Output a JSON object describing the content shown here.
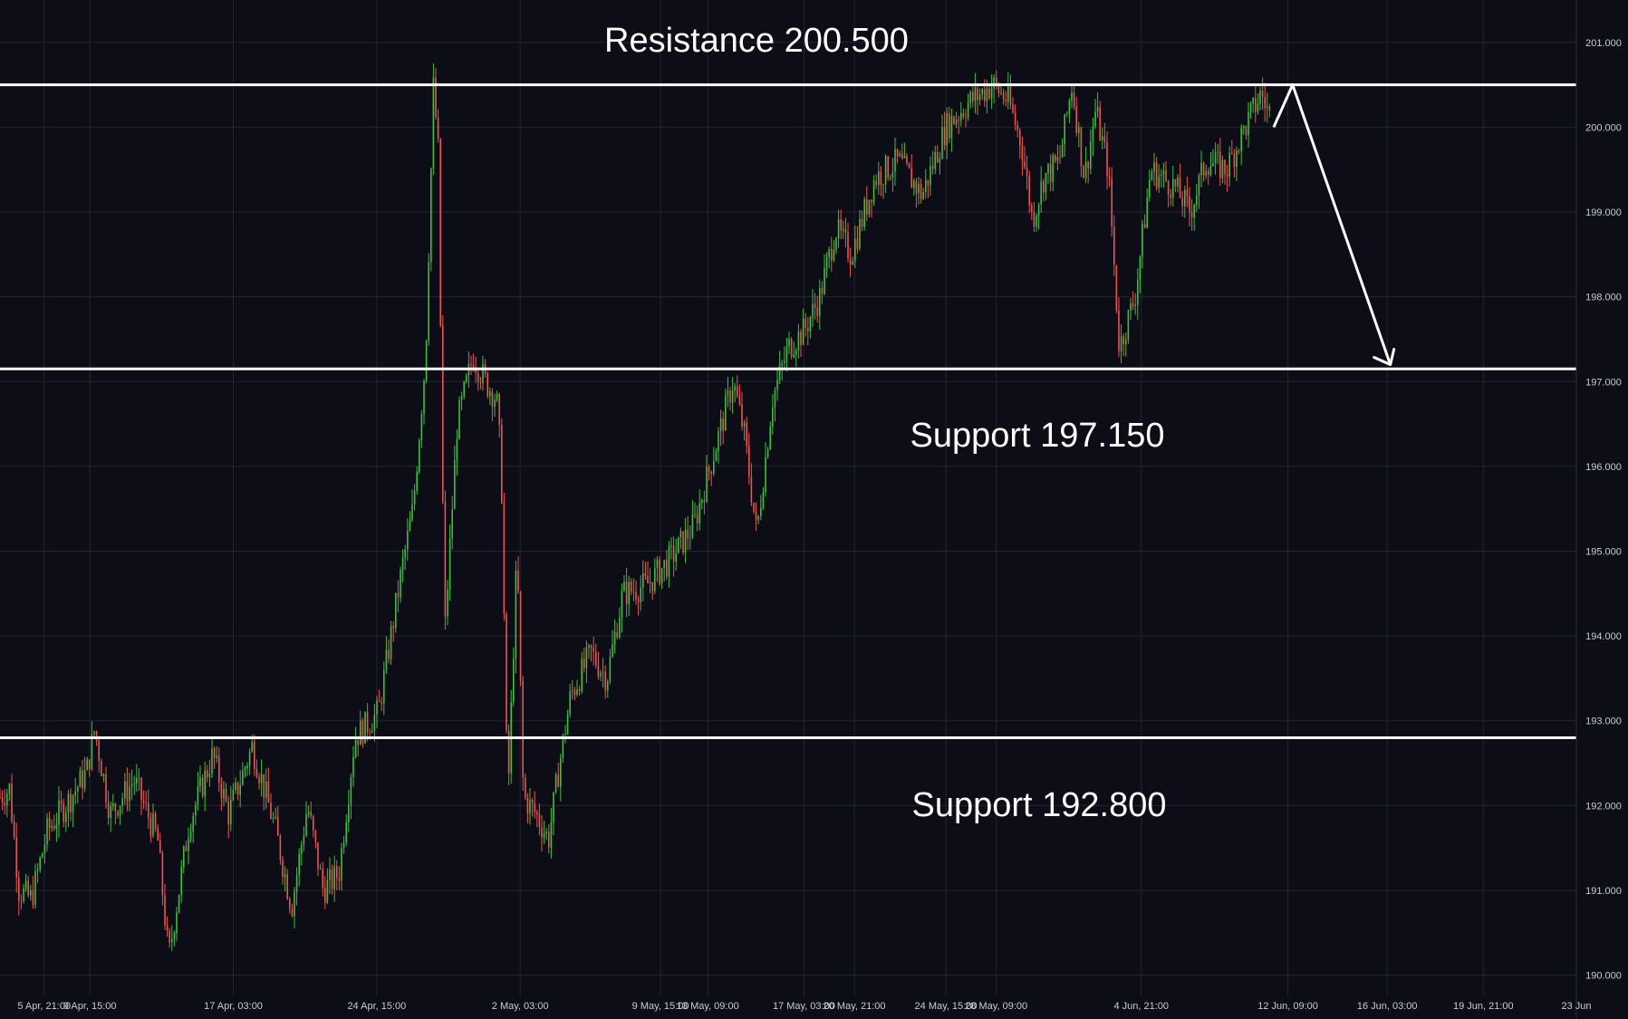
{
  "chart_data": {
    "type": "candlestick",
    "ylim": [
      189.75,
      201.5
    ],
    "y_ticks": [
      "190.000",
      "191.000",
      "192.000",
      "193.000",
      "194.000",
      "195.000",
      "196.000",
      "197.000",
      "198.000",
      "199.000",
      "200.000",
      "201.000"
    ],
    "x_ticks": [
      "5 Apr, 21:00",
      "9 Apr, 15:00",
      "17 Apr, 03:00",
      "24 Apr, 15:00",
      "2 May, 03:00",
      "9 May, 15:00",
      "13 May, 09:00",
      "17 May, 03:00",
      "20 May, 21:00",
      "24 May, 15:00",
      "28 May, 09:00",
      "4 Jun, 21:00",
      "12 Jun, 09:00",
      "16 Jun, 03:00",
      "19 Jun, 21:00",
      "23 Jun"
    ],
    "grid": true,
    "colors": {
      "up": "#26a69a",
      "up_bright": "#3fbf3f",
      "down": "#ef5350",
      "level": "#ffffff",
      "background": "#0c0d17"
    },
    "levels": [
      {
        "value": 200.5,
        "tag": "200.500",
        "label": "Resistance 200.500"
      },
      {
        "value": 197.15,
        "tag": "197.150",
        "label": "Support 197.150"
      },
      {
        "value": 192.8,
        "tag": "192.800",
        "label": "Support 192.800"
      }
    ],
    "price_path": [
      [
        0,
        192.1
      ],
      [
        0.006,
        192.2
      ],
      [
        0.012,
        191.0
      ],
      [
        0.02,
        190.9
      ],
      [
        0.03,
        191.7
      ],
      [
        0.045,
        192.1
      ],
      [
        0.055,
        192.4
      ],
      [
        0.06,
        192.9
      ],
      [
        0.07,
        191.9
      ],
      [
        0.085,
        192.3
      ],
      [
        0.1,
        191.6
      ],
      [
        0.107,
        190.2
      ],
      [
        0.12,
        191.8
      ],
      [
        0.135,
        192.6
      ],
      [
        0.145,
        191.9
      ],
      [
        0.16,
        192.7
      ],
      [
        0.175,
        191.7
      ],
      [
        0.185,
        190.8
      ],
      [
        0.195,
        192.0
      ],
      [
        0.205,
        191.0
      ],
      [
        0.215,
        191.2
      ],
      [
        0.225,
        192.8
      ],
      [
        0.24,
        193.1
      ],
      [
        0.255,
        194.8
      ],
      [
        0.262,
        195.5
      ],
      [
        0.27,
        197.3
      ],
      [
        0.275,
        200.5
      ],
      [
        0.278,
        199.7
      ],
      [
        0.282,
        194.0
      ],
      [
        0.29,
        196.5
      ],
      [
        0.3,
        197.3
      ],
      [
        0.308,
        197.0
      ],
      [
        0.315,
        196.8
      ],
      [
        0.318,
        196.0
      ],
      [
        0.322,
        192.0
      ],
      [
        0.328,
        195.0
      ],
      [
        0.332,
        192.1
      ],
      [
        0.34,
        191.9
      ],
      [
        0.348,
        191.6
      ],
      [
        0.355,
        192.5
      ],
      [
        0.362,
        193.3
      ],
      [
        0.375,
        193.8
      ],
      [
        0.385,
        193.5
      ],
      [
        0.395,
        194.5
      ],
      [
        0.41,
        194.6
      ],
      [
        0.425,
        194.9
      ],
      [
        0.44,
        195.3
      ],
      [
        0.455,
        196.3
      ],
      [
        0.465,
        197.0
      ],
      [
        0.472,
        196.4
      ],
      [
        0.48,
        195.2
      ],
      [
        0.49,
        196.8
      ],
      [
        0.5,
        197.4
      ],
      [
        0.51,
        197.6
      ],
      [
        0.52,
        198.0
      ],
      [
        0.53,
        198.8
      ],
      [
        0.54,
        198.5
      ],
      [
        0.555,
        199.4
      ],
      [
        0.57,
        199.6
      ],
      [
        0.585,
        199.2
      ],
      [
        0.6,
        200.0
      ],
      [
        0.615,
        200.3
      ],
      [
        0.63,
        200.5
      ],
      [
        0.64,
        200.3
      ],
      [
        0.648,
        199.8
      ],
      [
        0.655,
        198.9
      ],
      [
        0.662,
        199.4
      ],
      [
        0.672,
        199.6
      ],
      [
        0.68,
        200.5
      ],
      [
        0.688,
        199.4
      ],
      [
        0.695,
        200.2
      ],
      [
        0.703,
        199.5
      ],
      [
        0.71,
        197.4
      ],
      [
        0.72,
        198.0
      ],
      [
        0.73,
        199.5
      ],
      [
        0.745,
        199.3
      ],
      [
        0.755,
        199.0
      ],
      [
        0.765,
        199.6
      ],
      [
        0.778,
        199.5
      ],
      [
        0.79,
        200.0
      ],
      [
        0.8,
        200.4
      ],
      [
        0.808,
        200.0
      ]
    ],
    "projection": [
      [
        0.808,
        200.0
      ],
      [
        0.82,
        200.5
      ],
      [
        0.882,
        197.2
      ]
    ]
  }
}
